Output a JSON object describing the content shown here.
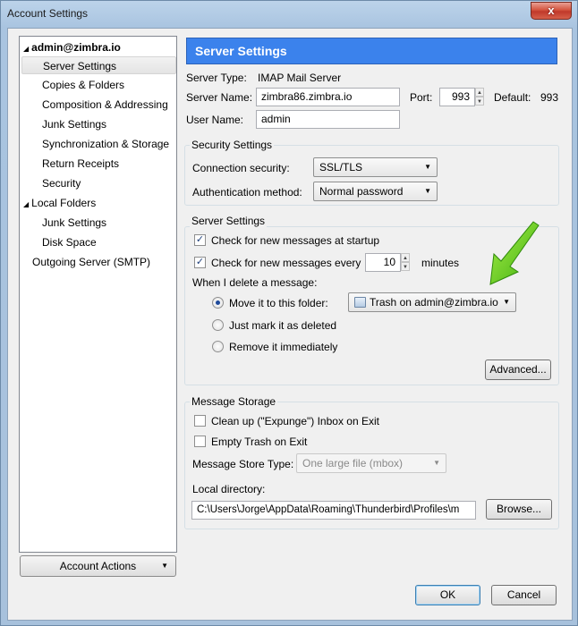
{
  "window": {
    "title": "Account Settings",
    "close_label": "x"
  },
  "sidebar": {
    "items": [
      {
        "label": "admin@zimbra.io"
      },
      {
        "label": "Server Settings"
      },
      {
        "label": "Copies & Folders"
      },
      {
        "label": "Composition & Addressing"
      },
      {
        "label": "Junk Settings"
      },
      {
        "label": "Synchronization & Storage"
      },
      {
        "label": "Return Receipts"
      },
      {
        "label": "Security"
      },
      {
        "label": "Local Folders"
      },
      {
        "label": "Junk Settings"
      },
      {
        "label": "Disk Space"
      },
      {
        "label": "Outgoing Server (SMTP)"
      }
    ],
    "account_actions_label": "Account Actions"
  },
  "panel": {
    "header": "Server Settings",
    "server_type_label": "Server Type:",
    "server_type_value": "IMAP Mail Server",
    "server_name_label": "Server Name:",
    "server_name_value": "zimbra86.zimbra.io",
    "port_label": "Port:",
    "port_value": "993",
    "default_label": "Default:",
    "default_value": "993",
    "user_name_label": "User Name:",
    "user_name_value": "admin"
  },
  "security": {
    "title": "Security Settings",
    "connection_label": "Connection security:",
    "connection_value": "SSL/TLS",
    "auth_label": "Authentication method:",
    "auth_value": "Normal password"
  },
  "server_settings": {
    "title": "Server Settings",
    "check_startup_label": "Check for new messages at startup",
    "check_startup_checked": true,
    "check_every_label": "Check for new messages every",
    "check_every_checked": true,
    "interval_value": "10",
    "minutes_label": "minutes",
    "delete_label": "When I delete a message:",
    "move_label": "Move it to this folder:",
    "folder_value": "Trash on admin@zimbra.io",
    "mark_label": "Just mark it as deleted",
    "remove_label": "Remove it immediately",
    "advanced_label": "Advanced..."
  },
  "storage": {
    "title": "Message Storage",
    "cleanup_label": "Clean up (\"Expunge\") Inbox on Exit",
    "empty_trash_label": "Empty Trash on Exit",
    "store_type_label": "Message Store Type:",
    "store_type_value": "One large file (mbox)",
    "local_dir_label": "Local directory:",
    "local_dir_value": "C:\\Users\\Jorge\\AppData\\Roaming\\Thunderbird\\Profiles\\m",
    "browse_label": "Browse..."
  },
  "footer": {
    "ok_label": "OK",
    "cancel_label": "Cancel"
  },
  "colors": {
    "header_bg": "#3b82ec",
    "arrow": "#6fd11f"
  }
}
